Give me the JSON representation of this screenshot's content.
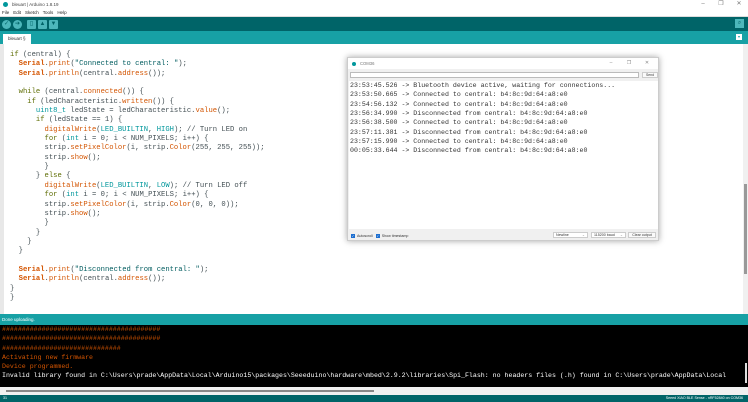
{
  "window": {
    "title": "bleuart | Arduino 1.8.19",
    "minimize": "–",
    "maximize": "❐",
    "close": "✕"
  },
  "menu": [
    "File",
    "Edit",
    "Sketch",
    "Tools",
    "Help"
  ],
  "toolbar": {
    "verify": "✓",
    "upload": "➔",
    "new": "▯",
    "open": "▲",
    "save": "▼",
    "serial_monitor": "⌕"
  },
  "tab": {
    "label": "bleuart §",
    "menu": "▾"
  },
  "code": [
    [
      [
        "if ",
        "k"
      ],
      [
        "(central) {",
        "n"
      ]
    ],
    [
      [
        "  ",
        ""
      ],
      [
        "Serial",
        "b"
      ],
      [
        ".",
        "n"
      ],
      [
        "print",
        "f"
      ],
      [
        "(",
        "n"
      ],
      [
        "\"Connected to central: \"",
        "s"
      ],
      [
        ");",
        "n"
      ]
    ],
    [
      [
        "  ",
        ""
      ],
      [
        "Serial",
        "b"
      ],
      [
        ".",
        "n"
      ],
      [
        "println",
        "f"
      ],
      [
        "(central.",
        "n"
      ],
      [
        "address",
        "f"
      ],
      [
        "());",
        "n"
      ]
    ],
    [
      [
        "",
        ""
      ]
    ],
    [
      [
        "  ",
        ""
      ],
      [
        "while ",
        "k"
      ],
      [
        "(central.",
        "n"
      ],
      [
        "connected",
        "f"
      ],
      [
        "()) {",
        "n"
      ]
    ],
    [
      [
        "    ",
        ""
      ],
      [
        "if ",
        "k"
      ],
      [
        "(ledCharacteristic.",
        "n"
      ],
      [
        "written",
        "f"
      ],
      [
        "()) {",
        "n"
      ]
    ],
    [
      [
        "      ",
        ""
      ],
      [
        "uint8_t",
        "t"
      ],
      [
        " ledState = ledCharacteristic.",
        "n"
      ],
      [
        "value",
        "f"
      ],
      [
        "();",
        "n"
      ]
    ],
    [
      [
        "      ",
        ""
      ],
      [
        "if ",
        "k"
      ],
      [
        "(ledState == 1) {",
        "n"
      ]
    ],
    [
      [
        "        ",
        ""
      ],
      [
        "digitalWrite",
        "f"
      ],
      [
        "(",
        "n"
      ],
      [
        "LED_BUILTIN",
        "t"
      ],
      [
        ", ",
        "n"
      ],
      [
        "HIGH",
        "t"
      ],
      [
        "); ",
        "n"
      ],
      [
        "// Turn LED on",
        "n"
      ]
    ],
    [
      [
        "        ",
        ""
      ],
      [
        "for ",
        "k"
      ],
      [
        "(",
        "n"
      ],
      [
        "int",
        "t"
      ],
      [
        " i = 0; i < NUM_PIXELS; i++) {",
        "n"
      ]
    ],
    [
      [
        "        strip.",
        ""
      ],
      [
        "setPixelColor",
        "f"
      ],
      [
        "(i, strip.",
        "n"
      ],
      [
        "Color",
        "f"
      ],
      [
        "(255, 255, 255));",
        "n"
      ]
    ],
    [
      [
        "        strip.",
        ""
      ],
      [
        "show",
        "f"
      ],
      [
        "();",
        "n"
      ]
    ],
    [
      [
        "        }",
        ""
      ]
    ],
    [
      [
        "      } ",
        ""
      ],
      [
        "else ",
        "k"
      ],
      [
        "{",
        "n"
      ]
    ],
    [
      [
        "        ",
        ""
      ],
      [
        "digitalWrite",
        "f"
      ],
      [
        "(",
        "n"
      ],
      [
        "LED_BUILTIN",
        "t"
      ],
      [
        ", ",
        "n"
      ],
      [
        "LOW",
        "t"
      ],
      [
        "); ",
        "n"
      ],
      [
        "// Turn LED off",
        "n"
      ]
    ],
    [
      [
        "        ",
        ""
      ],
      [
        "for ",
        "k"
      ],
      [
        "(",
        "n"
      ],
      [
        "int",
        "t"
      ],
      [
        " i = 0; i < NUM_PIXELS; i++) {",
        "n"
      ]
    ],
    [
      [
        "        strip.",
        ""
      ],
      [
        "setPixelColor",
        "f"
      ],
      [
        "(i, strip.",
        "n"
      ],
      [
        "Color",
        "f"
      ],
      [
        "(0, 0, 0));",
        "n"
      ]
    ],
    [
      [
        "        strip.",
        ""
      ],
      [
        "show",
        "f"
      ],
      [
        "();",
        "n"
      ]
    ],
    [
      [
        "        }",
        ""
      ]
    ],
    [
      [
        "      }",
        ""
      ]
    ],
    [
      [
        "    }",
        ""
      ]
    ],
    [
      [
        "  }",
        ""
      ]
    ],
    [
      [
        "",
        ""
      ]
    ],
    [
      [
        "  ",
        ""
      ],
      [
        "Serial",
        "b"
      ],
      [
        ".",
        "n"
      ],
      [
        "print",
        "f"
      ],
      [
        "(",
        "n"
      ],
      [
        "\"Disconnected from central: \"",
        "s"
      ],
      [
        ");",
        "n"
      ]
    ],
    [
      [
        "  ",
        ""
      ],
      [
        "Serial",
        "b"
      ],
      [
        ".",
        "n"
      ],
      [
        "println",
        "f"
      ],
      [
        "(central.",
        "n"
      ],
      [
        "address",
        "f"
      ],
      [
        "());",
        "n"
      ]
    ],
    [
      [
        "}",
        ""
      ]
    ],
    [
      [
        "}",
        ""
      ]
    ]
  ],
  "status": {
    "message": "Done uploading."
  },
  "console": [
    {
      "text": "########################################",
      "kind": "o"
    },
    {
      "text": "########################################",
      "kind": "o"
    },
    {
      "text": "##############################",
      "kind": "o"
    },
    {
      "text": "Activating new firmware",
      "kind": "o"
    },
    {
      "text": "Device programmed.",
      "kind": "o"
    },
    {
      "text": "Invalid library found in C:\\Users\\prade\\AppData\\Local\\Arduino15\\packages\\Seeeduino\\hardware\\mbed\\2.9.2\\libraries\\Spi_Flash: no headers files (.h) found in C:\\Users\\prade\\AppData\\Local",
      "kind": "w"
    }
  ],
  "bottom": {
    "line": "31",
    "board": "Seeed XIAO BLE Sense - nRF52840 on COM36"
  },
  "serial_monitor": {
    "title": "COM36",
    "input_value": "",
    "send": "Send",
    "output": [
      "23:53:45.526 -> Bluetooth device active, waiting for connections...",
      "23:53:50.665 -> Connected to central: b4:8c:9d:64:a8:e0",
      "23:54:56.132 -> Connected to central: b4:8c:9d:64:a8:e0",
      "23:56:34.990 -> Disconnected from central: b4:8c:9d:64:a8:e0",
      "23:56:38.500 -> Connected to central: b4:8c:9d:64:a8:e0",
      "23:57:11.381 -> Disconnected from central: b4:8c:9d:64:a8:e0",
      "23:57:15.990 -> Connected to central: b4:8c:9d:64:a8:e0",
      "00:05:33.644 -> Disconnected from central: b4:8c:9d:64:a8:e0"
    ],
    "autoscroll": "Autoscroll",
    "show_timestamp": "Show timestamp",
    "autoscroll_checked": true,
    "timestamp_checked": true,
    "line_ending": "Newline",
    "baud": "115200 baud",
    "clear": "Clear output",
    "check": "✓",
    "chevron": "⌄"
  },
  "colors": {
    "teal_dark": "#006468",
    "teal": "#17A1A5",
    "accent": "#00979C"
  }
}
